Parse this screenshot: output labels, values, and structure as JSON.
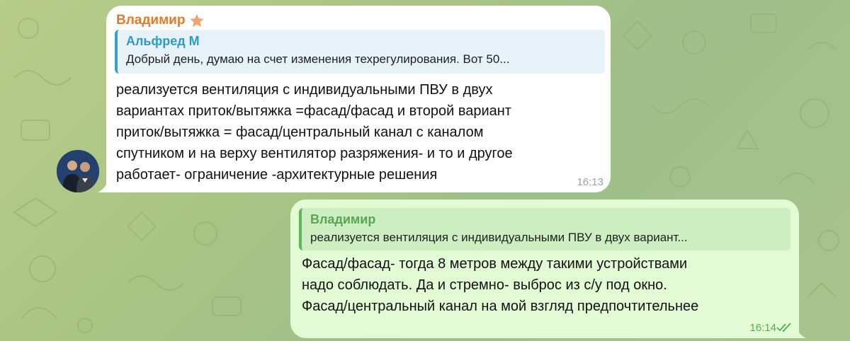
{
  "chat": {
    "incoming": {
      "sender": "Владимир",
      "reply": {
        "name": "Альфред М",
        "text": "Добрый день, думаю на счет изменения техрегулирования. Вот 50..."
      },
      "text": "реализуется вентиляция с индивидуальными ПВУ  в двух\nвариантах приток/вытяжка =фасад/фасад и второй вариант\nприток/вытяжка = фасад/центральный канал с каналом\nспутником и на верху вентилятор разряжения- и то и другое\nработает- ограничение -архитектурные решения",
      "time": "16:13"
    },
    "outgoing": {
      "reply": {
        "name": "Владимир",
        "text": "реализуется вентиляция с индивидуальными ПВУ в двух вариант..."
      },
      "text": "Фасад/фасад- тогда 8 метров между такими устройствами\nнадо соблюдать. Да и стремно- выброс из с/у под окно.\nФасад/центральный канал на мой взгляд предпочтительнее",
      "time": "16:14",
      "status_icon": "double-check-icon"
    }
  },
  "colors": {
    "sender": "#e07b2a",
    "reply_incoming": "#2e9bc6",
    "reply_outgoing": "#55a84f",
    "outgoing_bubble": "#e2fbd4"
  }
}
